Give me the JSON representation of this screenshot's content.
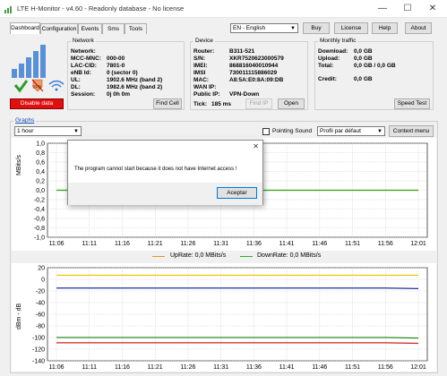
{
  "window": {
    "title": "LTE H-Monitor - v4.60 - Readonly database - No license",
    "minimize": "—",
    "maximize": "☐",
    "close": "✕"
  },
  "tabs": [
    {
      "label": "Dashboard",
      "active": true
    },
    {
      "label": "Configuration",
      "active": false
    },
    {
      "label": "Events",
      "active": false
    },
    {
      "label": "Sms",
      "active": false
    },
    {
      "label": "Tools",
      "active": false
    }
  ],
  "top_controls": {
    "language": "EN - English",
    "buy": "Buy",
    "license": "License",
    "help": "Help",
    "about": "About"
  },
  "status": {
    "disable_data": "Disable data",
    "vpn_label": "VPN"
  },
  "network": {
    "title": "Network",
    "rows": [
      {
        "label": "Network:",
        "value": ""
      },
      {
        "label": "MCC-MNC:",
        "value": "000-00"
      },
      {
        "label": "LAC-CID:",
        "value": "7801-0"
      },
      {
        "label": "eNB Id:",
        "value": "0 (sector 0)"
      },
      {
        "label": "UL:",
        "value": "1902.6 MHz (band 2)"
      },
      {
        "label": "DL:",
        "value": "1982.6 MHz (band 2)"
      },
      {
        "label": "Session:",
        "value": "0j 0h 0m"
      }
    ],
    "find_cell": "Find Cell"
  },
  "device": {
    "title": "Device",
    "rows": [
      {
        "label": "Router:",
        "value": "B311-521"
      },
      {
        "label": "S/N:",
        "value": "XKR7520623000579"
      },
      {
        "label": "IMEI:",
        "value": "868816040010944"
      },
      {
        "label": "IMSI",
        "value": "730011115886029"
      },
      {
        "label": "MAC:",
        "value": "A8:5A:E0:8A:09:DB"
      },
      {
        "label": "WAN IP:",
        "value": ""
      },
      {
        "label": "Public IP:",
        "value": "VPN-Down"
      }
    ],
    "tick_label": "Tick:",
    "tick_value": "185 ms",
    "find_ip": "Find IP",
    "open": "Open"
  },
  "monthly": {
    "title": "Monthly traffic",
    "rows": [
      {
        "label": "Download:",
        "value": "0,0 GB"
      },
      {
        "label": "Upload:",
        "value": "0,0 GB"
      },
      {
        "label": "Total:",
        "value": "0,0 GB / 0,0 GB"
      },
      {
        "label": "Credit:",
        "value": "0,0 GB"
      }
    ],
    "speed_test": "Speed Test"
  },
  "graphs": {
    "title": "Graphs",
    "range": "1 hour",
    "pointing_sound": "Pointing Sound",
    "profile": "Profil par défaut",
    "context_menu": "Context menu"
  },
  "chart_data": [
    {
      "type": "line",
      "ylabel": "MBits/s",
      "ylim": [
        -1.0,
        1.0
      ],
      "yticks": [
        "1,0",
        "0,8",
        "0,6",
        "0,4",
        "0,2",
        "0,0",
        "-0,2",
        "-0,4",
        "-0,6",
        "-0,8",
        "-1,0"
      ],
      "x": [
        "11:06",
        "11:11",
        "11:16",
        "11:21",
        "11:26",
        "11:31",
        "11:36",
        "11:41",
        "11:46",
        "11:51",
        "11:56",
        "12:01"
      ],
      "series": [
        {
          "name": "UpRate: 0,0 MBits/s",
          "color": "#f28c28",
          "values": [
            0,
            0,
            0,
            0,
            0,
            0,
            0,
            0,
            0,
            0,
            0,
            0
          ]
        },
        {
          "name": "DownRate: 0,0 MBits/s",
          "color": "#2eaa2e",
          "values": [
            0,
            0,
            0,
            0,
            0,
            0,
            0,
            0,
            0,
            0,
            0,
            0
          ]
        }
      ],
      "grid": true
    },
    {
      "type": "line",
      "ylabel": "dBm - dB",
      "ylim": [
        -140,
        20
      ],
      "yticks": [
        "20",
        "0",
        "-20",
        "-40",
        "-60",
        "-80",
        "-100",
        "-120",
        "-140"
      ],
      "x": [
        "11:06",
        "11:11",
        "11:16",
        "11:21",
        "11:26",
        "11:31",
        "11:36",
        "11:41",
        "11:46",
        "11:51",
        "11:56",
        "12:01"
      ],
      "series": [
        {
          "color": "#e8c200",
          "values": [
            7,
            7,
            7,
            7,
            7,
            7,
            7,
            7,
            7,
            7,
            7,
            7
          ]
        },
        {
          "color": "#1f2f9e",
          "values": [
            -15,
            -15,
            -15,
            -15,
            -15,
            -15,
            -15,
            -15,
            -15,
            -15,
            -15,
            -16
          ]
        },
        {
          "color": "#2b8a2b",
          "values": [
            -100,
            -100,
            -100,
            -100,
            -100,
            -100,
            -100,
            -100,
            -100,
            -100,
            -100,
            -101
          ]
        },
        {
          "color": "#d32020",
          "values": [
            -109,
            -109,
            -109,
            -109,
            -109,
            -109,
            -109,
            -109,
            -109,
            -109,
            -109,
            -110
          ]
        }
      ],
      "grid": true
    }
  ],
  "dialog": {
    "message": "The program cannot start because it does not have Internet access !",
    "close": "✕",
    "ok": "Aceptar"
  }
}
